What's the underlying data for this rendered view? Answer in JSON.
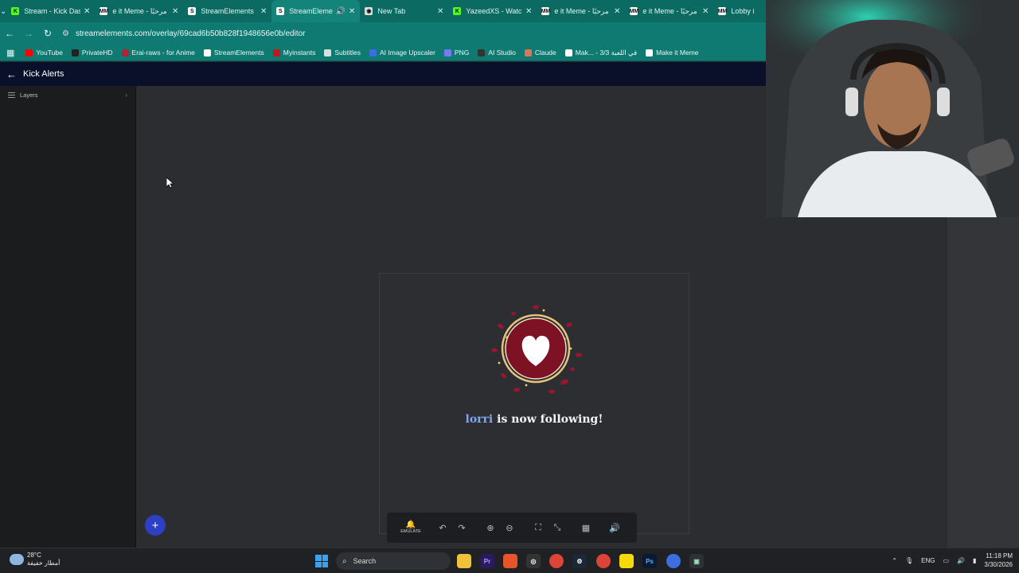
{
  "tabs": [
    {
      "label": "Stream - Kick Das",
      "fav_color": "#53fc18",
      "fav_text": "K"
    },
    {
      "label": "e it Meme - مرحبًا",
      "fav_color": "#ffffff",
      "fav_text": "MM"
    },
    {
      "label": "StreamElements",
      "fav_color": "#ffffff",
      "fav_text": "S"
    },
    {
      "label": "StreamElemen",
      "fav_color": "#ffffff",
      "fav_text": "S",
      "active": true,
      "audio": "🔊"
    },
    {
      "label": "New Tab",
      "fav_color": "#dddddd",
      "fav_text": "◉"
    },
    {
      "label": "YazeedXS - Watch",
      "fav_color": "#53fc18",
      "fav_text": "K"
    },
    {
      "label": "e it Meme - مرحبًا",
      "fav_color": "#ffffff",
      "fav_text": "MM"
    },
    {
      "label": "e it Meme - مرحبًا",
      "fav_color": "#ffffff",
      "fav_text": "MM"
    },
    {
      "label": "Lobby i",
      "fav_color": "#ffffff",
      "fav_text": "MM"
    }
  ],
  "nav": {
    "url": "streamelements.com/overlay/69cad6b50b828f1948656e0b/editor"
  },
  "bookmarks": [
    {
      "label": "YouTube",
      "color": "#ff0000"
    },
    {
      "label": "PrivateHD",
      "color": "#222222"
    },
    {
      "label": "Erai-raws - for Anime",
      "color": "#b0233a"
    },
    {
      "label": "StreamElements",
      "color": "#ffffff"
    },
    {
      "label": "Myinstants",
      "color": "#c4161c"
    },
    {
      "label": "Subtitles",
      "color": "#dddddd"
    },
    {
      "label": "AI Image Upscaler",
      "color": "#3b6fe0"
    },
    {
      "label": "PNG",
      "color": "#7a7af0"
    },
    {
      "label": "AI Studio",
      "color": "#333333"
    },
    {
      "label": "Claude",
      "color": "#d97757"
    },
    {
      "label": "Mak... - 3/3 في اللعبة",
      "color": "#ffffff"
    },
    {
      "label": "Make it Meme",
      "color": "#ffffff"
    }
  ],
  "app": {
    "title": "Kick Alerts"
  },
  "sidebar": {
    "layers_label": "Layers"
  },
  "alert": {
    "username": "lorri",
    "message": "is now following!"
  },
  "toolbar": {
    "emulate_label": "EMULATE"
  },
  "taskbar": {
    "weather_temp": "28°C",
    "weather_desc": "أمطار خفيفة",
    "search_placeholder": "Search",
    "lang": "ENG",
    "time": "11:18 PM",
    "date": "3/30/2026"
  }
}
